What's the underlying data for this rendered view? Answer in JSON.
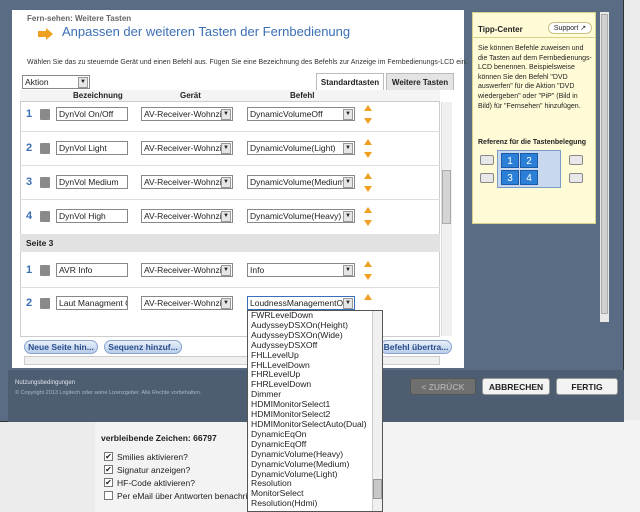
{
  "page": {
    "remaining_chars_label": "verbleibende Zeichen: 66797",
    "options": [
      {
        "label": "Smilies aktivieren?",
        "checked": true
      },
      {
        "label": "Signatur anzeigen?",
        "checked": true
      },
      {
        "label": "HF-Code aktivieren?",
        "checked": true
      },
      {
        "label": "Per eMail über Antworten benachrichtig",
        "checked": false
      }
    ]
  },
  "window": {
    "breadcrumb": "Fern-sehen: Weitere Tasten",
    "title": "Anpassen der weiteren Tasten der Fernbedienung",
    "instructions": "Wählen Sie das zu steuernde Gerät und einen Befehl aus. Fügen Sie eine Bezeichnung des Befehls zur Anzeige im Fernbedienungs-LCD ein.",
    "action_select": "Aktion",
    "tabs": [
      "Standardtasten",
      "Weitere Tasten"
    ],
    "columns": [
      "Bezeichnung",
      "Gerät",
      "Befehl"
    ],
    "section_label": "Seite 3",
    "rows_page2": [
      {
        "num": "1",
        "name": "DynVol On/Off",
        "device": "AV-Receiver-Wohnzi",
        "command": "DynamicVolumeOff"
      },
      {
        "num": "2",
        "name": "DynVol Light",
        "device": "AV-Receiver-Wohnzi",
        "command": "DynamicVolume(Light)"
      },
      {
        "num": "3",
        "name": "DynVol Medium",
        "device": "AV-Receiver-Wohnzi",
        "command": "DynamicVolume(Medium"
      },
      {
        "num": "4",
        "name": "DynVol High",
        "device": "AV-Receiver-Wohnzi",
        "command": "DynamicVolume(Heavy)"
      }
    ],
    "rows_page3": [
      {
        "num": "1",
        "name": "AVR Info",
        "device": "AV-Receiver-Wohnzi",
        "command": "Info"
      },
      {
        "num": "2",
        "name": "Laut Managment O",
        "device": "AV-Receiver-Wohnzi",
        "command": "LoudnessManagementO"
      }
    ],
    "buttons": {
      "new_page": "Neue Seite hin...",
      "add_sequence": "Sequenz hinzuf...",
      "transfer": "Befehl übertra...",
      "back": "< ZURÜCK",
      "cancel": "ABBRECHEN",
      "finish": "FERTIG"
    },
    "footer_terms": "Nutzungsbedingungen",
    "footer_copyright": "© Copyright 2013 Logitech oder seine Lizenzgeber. Alle Rechte vorbehalten."
  },
  "tip": {
    "title": "Tipp-Center",
    "support": "Support",
    "text": "Sie können Befehle zuweisen und die Tasten auf dem Fernbedienungs-LCD benennen. Beispielsweise können Sie den Befehl \"DVD auswerfen\" für die Aktion \"DVD wiedergeben\" oder \"PiP\" (Bild in Bild) für \"Fernsehen\" hinzufügen.",
    "ref_title": "Referenz für die Tastenbelegung",
    "keys": [
      "1",
      "2",
      "3",
      "4"
    ]
  },
  "dropdown": {
    "options": [
      "FWRLevelDown",
      "AudysseyDSXOn(Height)",
      "AudysseyDSXOn(Wide)",
      "AudysseyDSXOff",
      "FHLLevelUp",
      "FHLLevelDown",
      "FHRLevelUp",
      "FHRLevelDown",
      "Dimmer",
      "HDMIMonitorSelect1",
      "HDMIMonitorSelect2",
      "HDMIMonitorSelectAuto(Dual)",
      "DynamicEqOn",
      "DynamicEqOff",
      "DynamicVolume(Heavy)",
      "DynamicVolume(Medium)",
      "DynamicVolume(Light)",
      "Resolution",
      "MonitorSelect",
      "Resolution(Hdmi)"
    ]
  },
  "colors": {
    "accent": "#3b6fb5",
    "arrow": "#f0a020",
    "key_blue": "#2c7fd6"
  }
}
